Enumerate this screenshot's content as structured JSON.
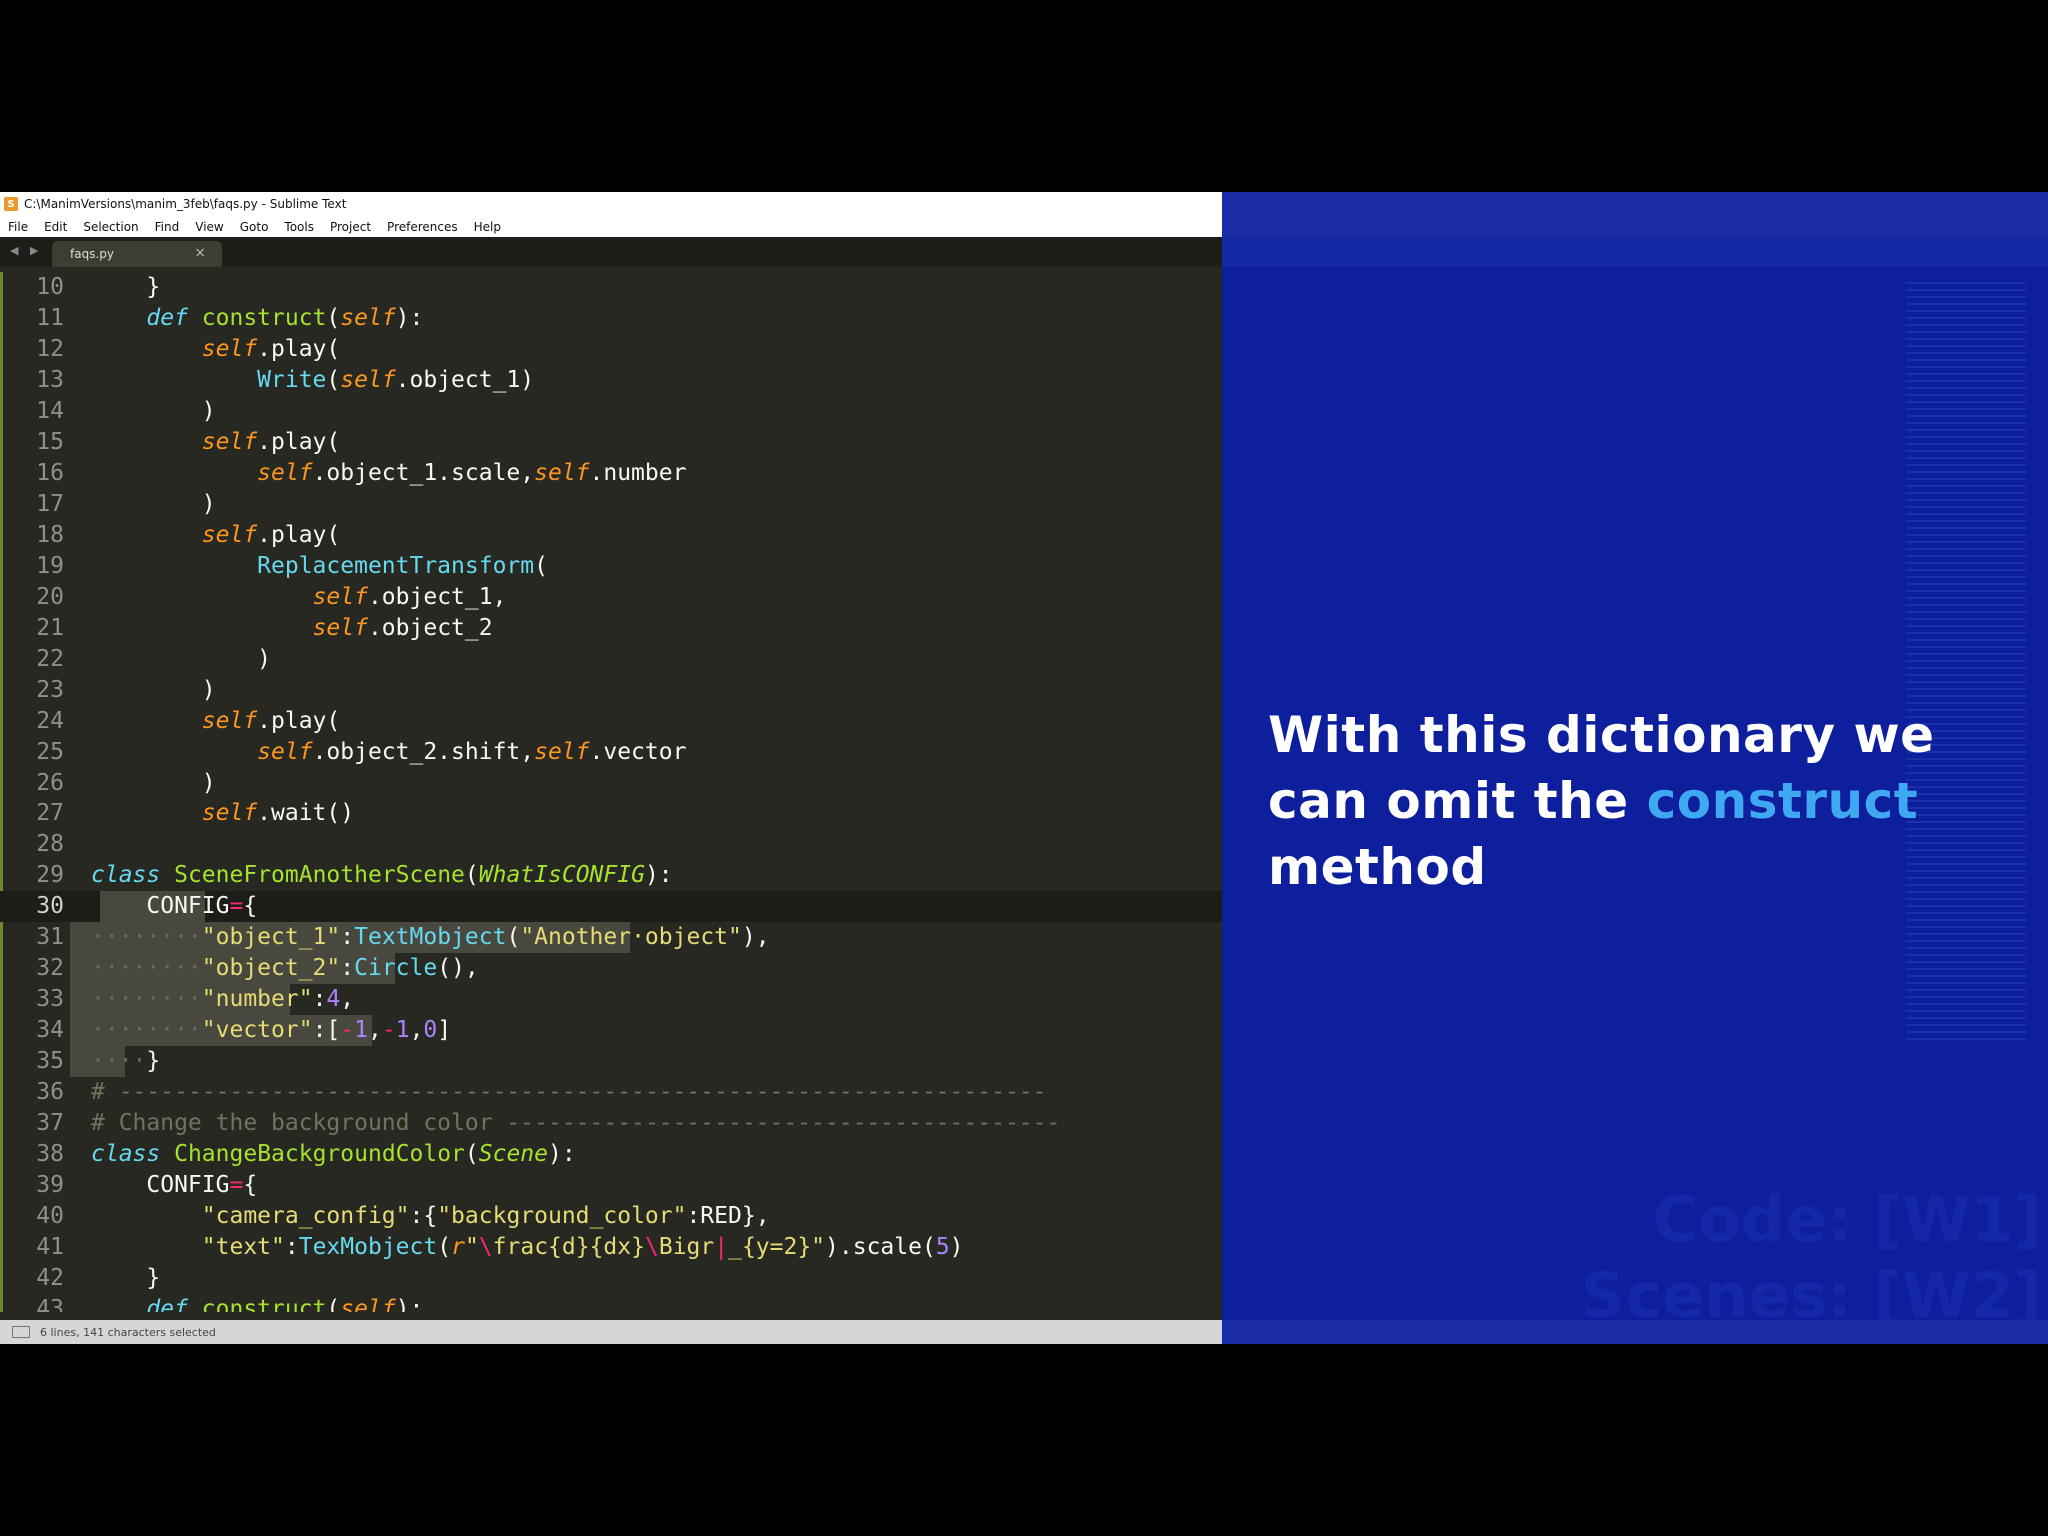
{
  "window": {
    "title": "C:\\ManimVersions\\manim_3feb\\faqs.py - Sublime Text",
    "app_icon": "sublime-text-icon"
  },
  "menu": [
    "File",
    "Edit",
    "Selection",
    "Find",
    "View",
    "Goto",
    "Tools",
    "Project",
    "Preferences",
    "Help"
  ],
  "tab": {
    "name": "faqs.py",
    "close": "×"
  },
  "nav_arrows": "◀ ▶",
  "code_lines": [
    {
      "n": "10",
      "html": "    }"
    },
    {
      "n": "11",
      "html": "    <span class='kw'>def</span> <span class='fn'>construct</span>(<span class='sf'>self</span>):"
    },
    {
      "n": "12",
      "html": "        <span class='sf'>self</span>.play("
    },
    {
      "n": "13",
      "html": "            <span class='bi'>Write</span>(<span class='sf'>self</span>.object_1)"
    },
    {
      "n": "14",
      "html": "        )"
    },
    {
      "n": "15",
      "html": "        <span class='sf'>self</span>.play("
    },
    {
      "n": "16",
      "html": "            <span class='sf'>self</span>.object_1.scale,<span class='sf'>self</span>.number"
    },
    {
      "n": "17",
      "html": "        )"
    },
    {
      "n": "18",
      "html": "        <span class='sf'>self</span>.play("
    },
    {
      "n": "19",
      "html": "            <span class='bi'>ReplacementTransform</span>("
    },
    {
      "n": "20",
      "html": "                <span class='sf'>self</span>.object_1,"
    },
    {
      "n": "21",
      "html": "                <span class='sf'>self</span>.object_2"
    },
    {
      "n": "22",
      "html": "            )"
    },
    {
      "n": "23",
      "html": "        )"
    },
    {
      "n": "24",
      "html": "        <span class='sf'>self</span>.play("
    },
    {
      "n": "25",
      "html": "            <span class='sf'>self</span>.object_2.shift,<span class='sf'>self</span>.vector"
    },
    {
      "n": "26",
      "html": "        )"
    },
    {
      "n": "27",
      "html": "        <span class='sf'>self</span>.wait()"
    },
    {
      "n": "28",
      "html": ""
    },
    {
      "n": "29",
      "html": "<span class='kw'>class</span> <span class='fn'>SceneFromAnotherScene</span>(<span class='ar'>WhatIsCONFIG</span>):"
    },
    {
      "n": "30",
      "html": "    CONFIG<span class='op'>=</span>{",
      "current": true
    },
    {
      "n": "31",
      "html": "<span class='ws'>········</span><span class='st'>\"object_1\"</span>:<span class='bi'>TextMobject</span>(<span class='st'>\"Another·object\"</span>),"
    },
    {
      "n": "32",
      "html": "<span class='ws'>········</span><span class='st'>\"object_2\"</span>:<span class='bi'>Circle</span>(),"
    },
    {
      "n": "33",
      "html": "<span class='ws'>········</span><span class='st'>\"number\"</span>:<span class='nm'>4</span>,"
    },
    {
      "n": "34",
      "html": "<span class='ws'>········</span><span class='st'>\"vector\"</span>:[<span class='op'>-</span><span class='nm'>1</span>,<span class='op'>-</span><span class='nm'>1</span>,<span class='nm'>0</span>]"
    },
    {
      "n": "35",
      "html": "<span class='ws'>····</span>}"
    },
    {
      "n": "36",
      "html": "<span class='cm'># -------------------------------------------------------------------</span>"
    },
    {
      "n": "37",
      "html": "<span class='cm'># Change the background color ----------------------------------------</span>"
    },
    {
      "n": "38",
      "html": "<span class='kw'>class</span> <span class='fn'>ChangeBackgroundColor</span>(<span class='ar'>Scene</span>):"
    },
    {
      "n": "39",
      "html": "    CONFIG<span class='op'>=</span>{"
    },
    {
      "n": "40",
      "html": "        <span class='st'>\"camera_config\"</span>:{<span class='st'>\"background_color\"</span>:RED},"
    },
    {
      "n": "41",
      "html": "        <span class='st'>\"text\"</span>:<span class='bi'>TexMobject</span>(<span class='sf'>r</span><span class='st'>\"</span><span class='op'>\\</span><span class='st'>frac{d}{dx}</span><span class='op'>\\</span><span class='st'>Bigr</span><span class='op'>|</span><span class='st'>_{y=2}\"</span>).scale(<span class='nm'>5</span>)"
    },
    {
      "n": "42",
      "html": "    }"
    },
    {
      "n": "43",
      "html": "    <span class='kw'>def</span> <span class='fn'>construct</span>(<span class='sf'>self</span>):"
    }
  ],
  "status": {
    "text": "6 lines, 141 characters selected"
  },
  "caption": {
    "part1": "With this dictionary we can omit the ",
    "highlight": "construct",
    "part2": " method"
  },
  "ghost_text": {
    "line1": "Code: [W1]",
    "line2": "Scenes: [W2]"
  },
  "colors": {
    "editor_bg": "#272822",
    "slide_bg": "#0d1f9c",
    "highlight": "#3ea8f0"
  }
}
